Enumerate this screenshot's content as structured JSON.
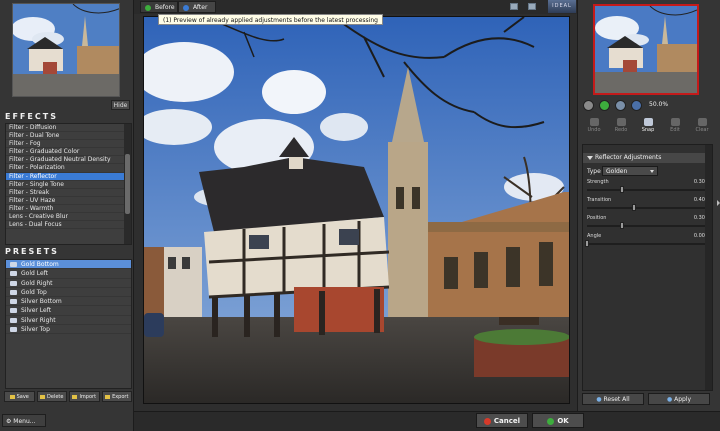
{
  "left": {
    "hide_label": "Hide",
    "effects_title": "EFFECTS",
    "effects": [
      "Filter - Diffusion",
      "Filter - Dual Tone",
      "Filter - Fog",
      "Filter - Graduated Color",
      "Filter - Graduated Neutral Density",
      "Filter - Polarization",
      "Filter - Reflector",
      "Filter - Single Tone",
      "Filter - Streak",
      "Filter - UV Haze",
      "Filter - Warmth",
      "Lens - Creative Blur",
      "Lens - Dual Focus"
    ],
    "selected_effect": "Filter - Reflector",
    "presets_title": "PRESETS",
    "presets": [
      "Gold Bottom",
      "Gold Left",
      "Gold Right",
      "Gold Top",
      "Silver Bottom",
      "Silver Left",
      "Silver Right",
      "Silver Top"
    ],
    "selected_preset": "Gold Bottom",
    "buttons": {
      "save": "Save",
      "delete": "Delete",
      "import": "Import",
      "export": "Export"
    },
    "menu_label": "Menu..."
  },
  "topbar": {
    "before_label": "Before",
    "after_label": "After",
    "logo_text": "IDEAL",
    "tooltip": "(1) Preview of already applied adjustments before the latest processing"
  },
  "right": {
    "zoom_label": "50.0%",
    "tools": [
      "Undo",
      "Redo",
      "Snap",
      "Edit",
      "Clear"
    ],
    "active_tool": "Snap",
    "panel_title": "Reflector Adjustments",
    "type_label": "Type",
    "type_value": "Golden",
    "sliders": [
      {
        "label": "Strength",
        "value": "0.30",
        "pos": 0.3
      },
      {
        "label": "Transition",
        "value": "0.40",
        "pos": 0.4
      },
      {
        "label": "Position",
        "value": "0.30",
        "pos": 0.3
      },
      {
        "label": "Angle",
        "value": "0.00",
        "pos": 0.0
      }
    ],
    "reset_label": "Reset All",
    "apply_label": "Apply"
  },
  "bottom": {
    "cancel_label": "Cancel",
    "ok_label": "OK"
  },
  "colors": {
    "accent": "#3a7bd5",
    "thumb_border": "#c41a1a"
  }
}
